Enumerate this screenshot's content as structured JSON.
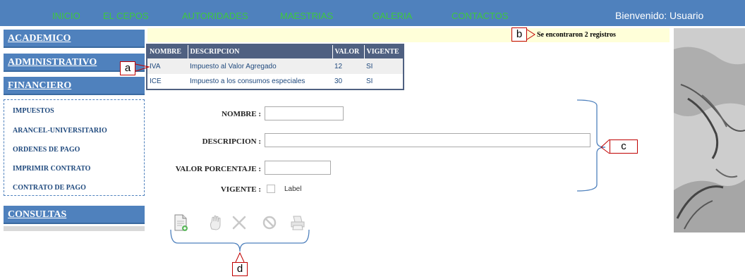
{
  "nav": {
    "items": [
      "INICIO",
      "EL CEPOS",
      "AUTORIDADES",
      "MAESTRIAS",
      "GALERIA",
      "CONTACTOS"
    ],
    "welcome": "Bienvenido: Usuario"
  },
  "sidebar": {
    "sections": [
      "ACADEMICO",
      "ADMINISTRATIVO",
      "FINANCIERO",
      "CONSULTAS"
    ],
    "financiero_items": [
      "IMPUESTOS",
      "ARANCEL-UNIVERSITARIO",
      "ORDENES DE PAGO",
      "IMPRIMIR CONTRATO",
      "CONTRATO DE PAGO"
    ]
  },
  "message": "Se encontraron 2 registros",
  "grid": {
    "headers": [
      "NOMBRE",
      "DESCRIPCION",
      "VALOR",
      "VIGENTE"
    ],
    "rows": [
      [
        "IVA",
        "Impuesto al Valor Agregado",
        "12",
        "SI"
      ],
      [
        "ICE",
        "Impuesto a los consumos especiales",
        "30",
        "SI"
      ]
    ]
  },
  "form": {
    "nombre_label": "NOMBRE :",
    "nombre_value": "",
    "descripcion_label": "DESCRIPCION :",
    "descripcion_value": "",
    "valor_label": "VALOR PORCENTAJE :",
    "valor_value": "",
    "vigente_label": "VIGENTE :",
    "vigente_checked": false,
    "checkbox_label": "Label"
  },
  "toolbar": {
    "icons": [
      "new-document-icon",
      "edit-hand-icon",
      "delete-x-icon",
      "cancel-icon",
      "print-icon"
    ]
  },
  "annotations": {
    "a": "a",
    "b": "b",
    "c": "c",
    "d": "d"
  },
  "colors": {
    "topbar": "#4f81bd",
    "nav_text": "#3ec83e",
    "grid_header": "#4f6081",
    "message_bar": "#ffffd9",
    "callout_border": "#c00000",
    "bracket": "#4f81bd"
  }
}
